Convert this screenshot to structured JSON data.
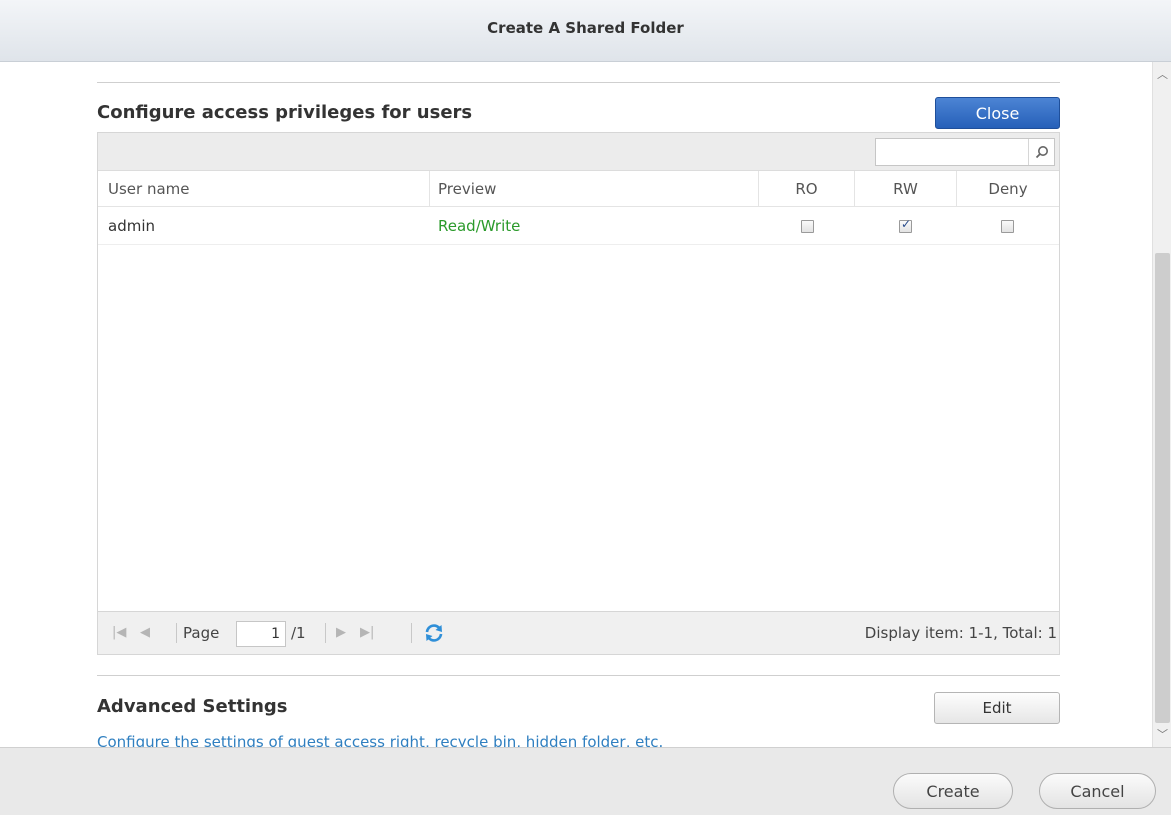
{
  "window": {
    "title": "Create A Shared Folder"
  },
  "access": {
    "heading": "Configure access privileges for users",
    "close_label": "Close",
    "search": {
      "placeholder": "",
      "icon": "search-icon"
    },
    "columns": {
      "user": "User name",
      "preview": "Preview",
      "ro": "RO",
      "rw": "RW",
      "deny": "Deny"
    },
    "rows": [
      {
        "user": "admin",
        "preview": "Read/Write",
        "ro": false,
        "rw": true,
        "deny": false
      }
    ],
    "pager": {
      "page_label": "Page",
      "page_value": "1",
      "total_label": "/1",
      "display_info": "Display item: 1-1, Total: 1"
    }
  },
  "advanced": {
    "heading": "Advanced Settings",
    "edit_label": "Edit",
    "description": "Configure the settings of guest access right, recycle bin, hidden folder, etc."
  },
  "footer": {
    "create_label": "Create",
    "cancel_label": "Cancel"
  },
  "colors": {
    "accent_blue": "#2f6cc4",
    "preview_green": "#2a9a2a",
    "link_blue": "#2f7fc0"
  }
}
